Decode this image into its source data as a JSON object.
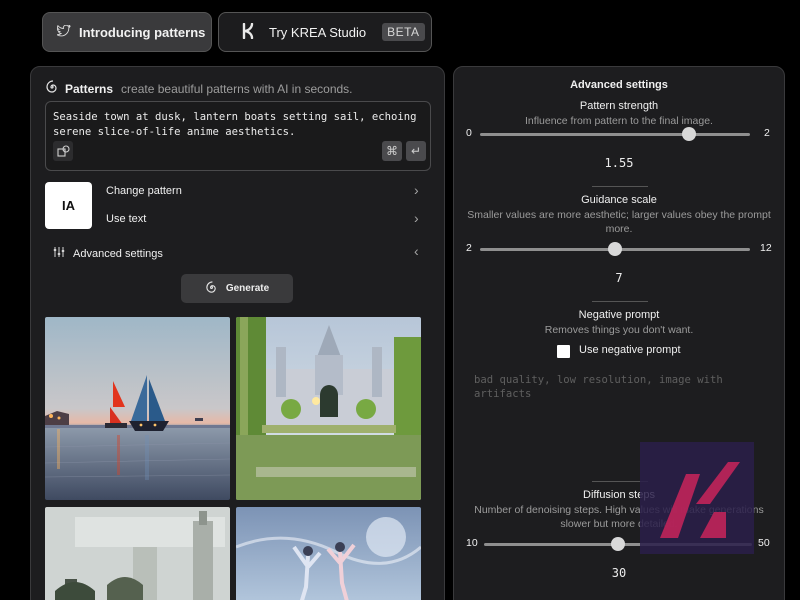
{
  "top_buttons": {
    "intro_label": "Introducing patterns",
    "studio_label": "Try KREA Studio",
    "studio_badge": "BETA"
  },
  "left_panel": {
    "title": "Patterns",
    "subtitle": "create beautiful patterns with AI in seconds.",
    "prompt": "Seaside town at dusk, lantern boats setting sail, echoing serene slice-of-life anime aesthetics.",
    "prompt_shortcut_glyph": "⌘",
    "prompt_enter_glyph": "↵",
    "pattern_thumb_text": "IA",
    "change_pattern_label": "Change pattern",
    "use_text_label": "Use text",
    "advanced_label": "Advanced settings",
    "generate_label": "Generate"
  },
  "advanced": {
    "title": "Advanced settings",
    "pattern_strength": {
      "label": "Pattern strength",
      "desc": "Influence from pattern to the final image.",
      "min": "0",
      "max": "2",
      "value": "1.55",
      "fraction": 0.775
    },
    "guidance_scale": {
      "label": "Guidance scale",
      "desc": "Smaller values are more aesthetic; larger values obey the prompt more.",
      "min": "2",
      "max": "12",
      "value": "7",
      "fraction": 0.5
    },
    "negative_prompt": {
      "label": "Negative prompt",
      "desc": "Removes things you don't want.",
      "checkbox_label": "Use negative prompt",
      "placeholder": "bad quality, low resolution, image with artifacts"
    },
    "diffusion_steps": {
      "label": "Diffusion steps",
      "desc": "Number of denoising steps. High values will make generations slower but more detailed.",
      "min": "10",
      "max": "50",
      "value": "30",
      "fraction": 0.5
    }
  },
  "colors": {
    "background": "#000000",
    "panel": "#1d1d1f",
    "button": "#3a3a3c",
    "watermark_bg": "#2a1f4a",
    "watermark_accent": "#c0245a"
  }
}
